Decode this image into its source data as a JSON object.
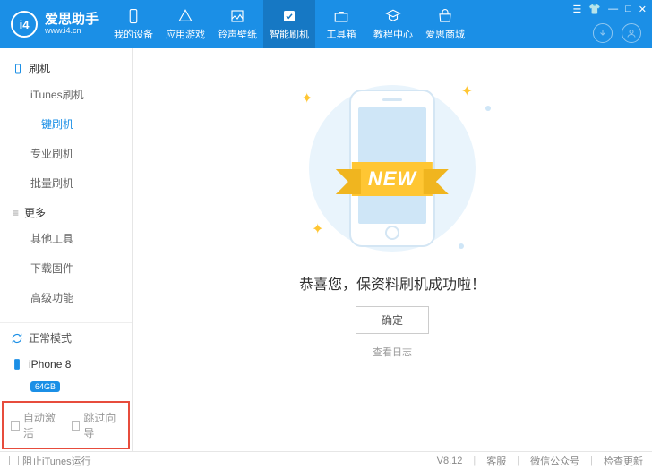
{
  "app": {
    "name": "爱思助手",
    "url": "www.i4.cn",
    "logo_text": "i4"
  },
  "nav": {
    "items": [
      {
        "label": "我的设备"
      },
      {
        "label": "应用游戏"
      },
      {
        "label": "铃声壁纸"
      },
      {
        "label": "智能刷机"
      },
      {
        "label": "工具箱"
      },
      {
        "label": "教程中心"
      },
      {
        "label": "爱思商城"
      }
    ],
    "active_index": 3
  },
  "sidebar": {
    "group1": {
      "title": "刷机",
      "items": [
        "iTunes刷机",
        "一键刷机",
        "专业刷机",
        "批量刷机"
      ],
      "active_index": 1
    },
    "group2": {
      "title": "更多",
      "items": [
        "其他工具",
        "下载固件",
        "高级功能"
      ]
    },
    "mode": "正常模式",
    "device": {
      "name": "iPhone 8",
      "capacity": "64GB"
    },
    "auto_activate": "自动激活",
    "skip_wizard": "跳过向导"
  },
  "main": {
    "ribbon": "NEW",
    "success": "恭喜您，保资料刷机成功啦！",
    "ok": "确定",
    "view_log": "查看日志"
  },
  "footer": {
    "stop_itunes": "阻止iTunes运行",
    "version": "V8.12",
    "service": "客服",
    "wechat": "微信公众号",
    "update": "检查更新"
  }
}
